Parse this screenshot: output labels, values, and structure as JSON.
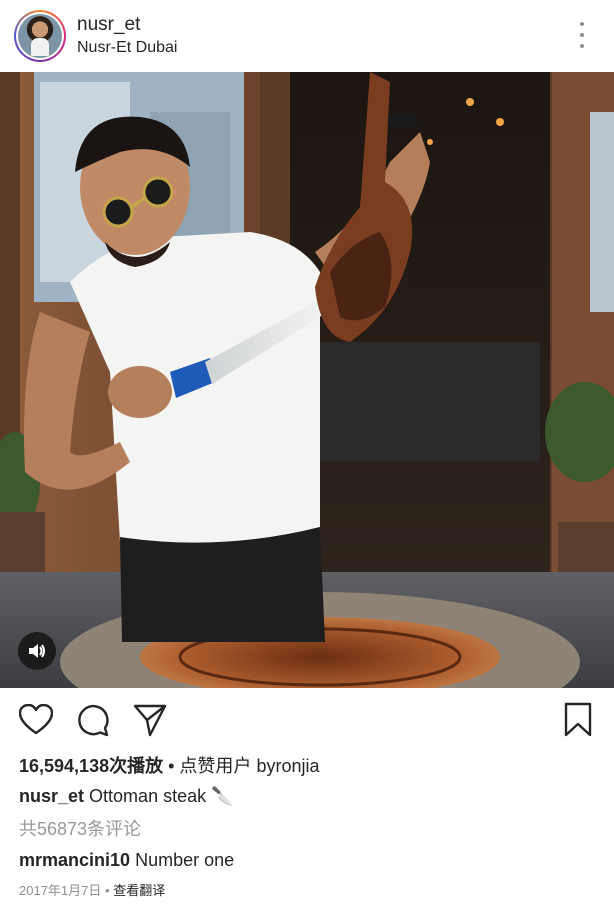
{
  "post": {
    "username": "nusr_et",
    "location": "Nusr-Et Dubai",
    "views_count": "16,594,138次播放",
    "likes_prefix": "点赞用户",
    "liked_by": "byronjia",
    "caption_user": "nusr_et",
    "caption_text": "Ottoman steak",
    "caption_emoji": "🔪",
    "comments_link": "共56873条评论",
    "comment": {
      "user": "mrmancini10",
      "text": "Number one"
    },
    "date": "2017年1月7日",
    "translate": "查看翻译"
  },
  "icons": {
    "more": "more-vertical-icon",
    "like": "heart-icon",
    "comment": "comment-bubble-icon",
    "share": "paper-plane-icon",
    "save": "bookmark-icon",
    "sound": "speaker-icon"
  },
  "colors": {
    "text": "#262626",
    "muted": "#999999",
    "accent_ring": "#dd2a7b"
  }
}
